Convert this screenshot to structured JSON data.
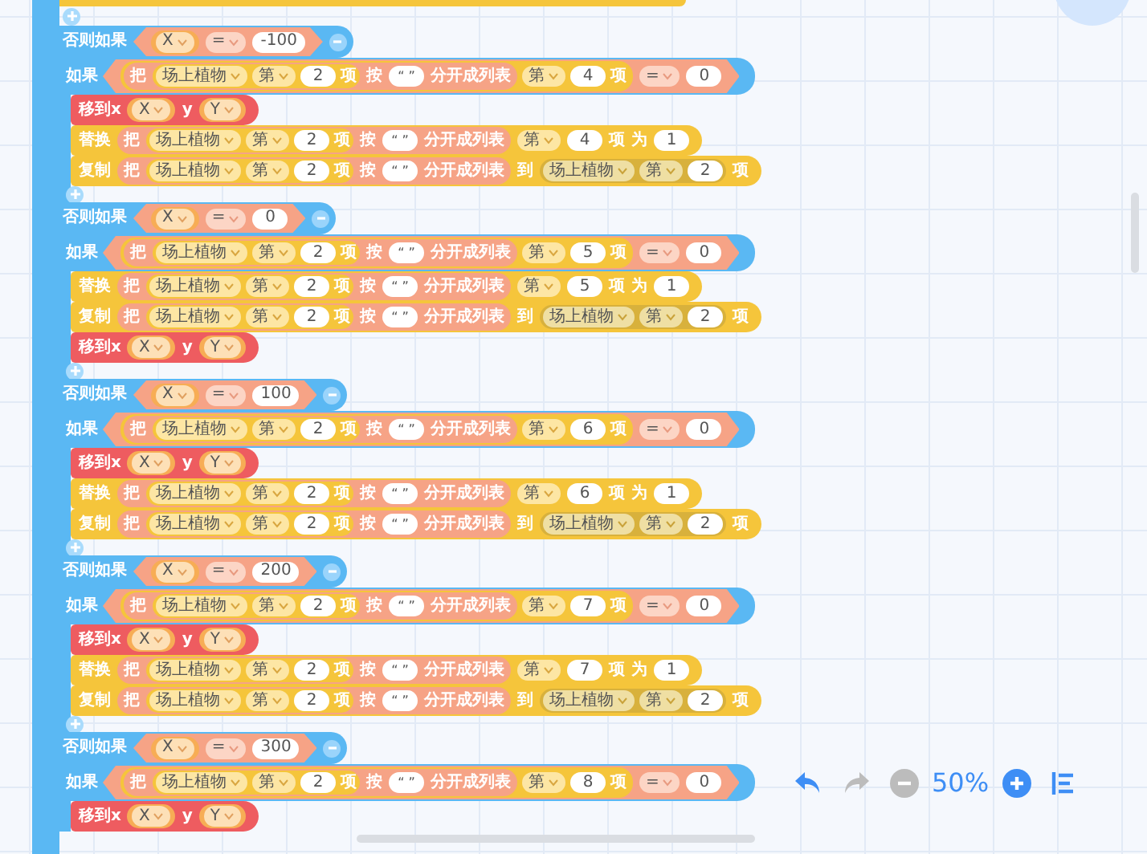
{
  "sections": [
    {
      "label": "否则如果",
      "var": "X",
      "op": "=",
      "value": "-100",
      "has_add_button": true,
      "if": {
        "label": "如果",
        "split": {
          "verb": "把",
          "list": "场上植物",
          "nth": "第",
          "index": "2",
          "item": "项",
          "by": "按",
          "sep": "“ ”",
          "action": "分开成列表"
        },
        "nth": "第",
        "index": "4",
        "item": "项",
        "op": "=",
        "value": "0"
      },
      "statements": [
        {
          "kind": "move",
          "label": "移到x",
          "x": "X",
          "y_label": "y",
          "y": "Y"
        },
        {
          "kind": "replace",
          "label": "替换",
          "split": {
            "verb": "把",
            "list": "场上植物",
            "nth": "第",
            "index": "2",
            "item": "项",
            "by": "按",
            "sep": "“ ”",
            "action": "分开成列表"
          },
          "nth": "第",
          "index": "4",
          "item": "项",
          "as": "为",
          "value": "1"
        },
        {
          "kind": "copy",
          "label": "复制",
          "split": {
            "verb": "把",
            "list": "场上植物",
            "nth": "第",
            "index": "2",
            "item": "项",
            "by": "按",
            "sep": "“ ”",
            "action": "分开成列表"
          },
          "to": "到",
          "list": "场上植物",
          "nth": "第",
          "index": "2",
          "item": "项"
        }
      ]
    },
    {
      "label": "否则如果",
      "var": "X",
      "op": "=",
      "value": "0",
      "has_add_button": true,
      "if": {
        "label": "如果",
        "split": {
          "verb": "把",
          "list": "场上植物",
          "nth": "第",
          "index": "2",
          "item": "项",
          "by": "按",
          "sep": "“ ”",
          "action": "分开成列表"
        },
        "nth": "第",
        "index": "5",
        "item": "项",
        "op": "=",
        "value": "0"
      },
      "statements": [
        {
          "kind": "replace",
          "label": "替换",
          "split": {
            "verb": "把",
            "list": "场上植物",
            "nth": "第",
            "index": "2",
            "item": "项",
            "by": "按",
            "sep": "“ ”",
            "action": "分开成列表"
          },
          "nth": "第",
          "index": "5",
          "item": "项",
          "as": "为",
          "value": "1"
        },
        {
          "kind": "copy",
          "label": "复制",
          "split": {
            "verb": "把",
            "list": "场上植物",
            "nth": "第",
            "index": "2",
            "item": "项",
            "by": "按",
            "sep": "“ ”",
            "action": "分开成列表"
          },
          "to": "到",
          "list": "场上植物",
          "nth": "第",
          "index": "2",
          "item": "项"
        },
        {
          "kind": "move",
          "label": "移到x",
          "x": "X",
          "y_label": "y",
          "y": "Y"
        }
      ]
    },
    {
      "label": "否则如果",
      "var": "X",
      "op": "=",
      "value": "100",
      "has_add_button": true,
      "if": {
        "label": "如果",
        "split": {
          "verb": "把",
          "list": "场上植物",
          "nth": "第",
          "index": "2",
          "item": "项",
          "by": "按",
          "sep": "“ ”",
          "action": "分开成列表"
        },
        "nth": "第",
        "index": "6",
        "item": "项",
        "op": "=",
        "value": "0"
      },
      "statements": [
        {
          "kind": "move",
          "label": "移到x",
          "x": "X",
          "y_label": "y",
          "y": "Y"
        },
        {
          "kind": "replace",
          "label": "替换",
          "split": {
            "verb": "把",
            "list": "场上植物",
            "nth": "第",
            "index": "2",
            "item": "项",
            "by": "按",
            "sep": "“ ”",
            "action": "分开成列表"
          },
          "nth": "第",
          "index": "6",
          "item": "项",
          "as": "为",
          "value": "1"
        },
        {
          "kind": "copy",
          "label": "复制",
          "split": {
            "verb": "把",
            "list": "场上植物",
            "nth": "第",
            "index": "2",
            "item": "项",
            "by": "按",
            "sep": "“ ”",
            "action": "分开成列表"
          },
          "to": "到",
          "list": "场上植物",
          "nth": "第",
          "index": "2",
          "item": "项"
        }
      ]
    },
    {
      "label": "否则如果",
      "var": "X",
      "op": "=",
      "value": "200",
      "has_add_button": true,
      "if": {
        "label": "如果",
        "split": {
          "verb": "把",
          "list": "场上植物",
          "nth": "第",
          "index": "2",
          "item": "项",
          "by": "按",
          "sep": "“ ”",
          "action": "分开成列表"
        },
        "nth": "第",
        "index": "7",
        "item": "项",
        "op": "=",
        "value": "0"
      },
      "statements": [
        {
          "kind": "move",
          "label": "移到x",
          "x": "X",
          "y_label": "y",
          "y": "Y"
        },
        {
          "kind": "replace",
          "label": "替换",
          "split": {
            "verb": "把",
            "list": "场上植物",
            "nth": "第",
            "index": "2",
            "item": "项",
            "by": "按",
            "sep": "“ ”",
            "action": "分开成列表"
          },
          "nth": "第",
          "index": "7",
          "item": "项",
          "as": "为",
          "value": "1"
        },
        {
          "kind": "copy",
          "label": "复制",
          "split": {
            "verb": "把",
            "list": "场上植物",
            "nth": "第",
            "index": "2",
            "item": "项",
            "by": "按",
            "sep": "“ ”",
            "action": "分开成列表"
          },
          "to": "到",
          "list": "场上植物",
          "nth": "第",
          "index": "2",
          "item": "项"
        }
      ]
    },
    {
      "label": "否则如果",
      "var": "X",
      "op": "=",
      "value": "300",
      "has_add_button": false,
      "if": {
        "label": "如果",
        "split": {
          "verb": "把",
          "list": "场上植物",
          "nth": "第",
          "index": "2",
          "item": "项",
          "by": "按",
          "sep": "“ ”",
          "action": "分开成列表"
        },
        "nth": "第",
        "index": "8",
        "item": "项",
        "op": "=",
        "value": "0"
      },
      "statements": [
        {
          "kind": "move",
          "label": "移到x",
          "x": "X",
          "y_label": "y",
          "y": "Y"
        }
      ]
    }
  ],
  "toolbar": {
    "undo": {
      "disabled": false
    },
    "redo": {
      "disabled": true
    },
    "zoom_out": {
      "disabled": true
    },
    "zoom": "50%",
    "zoom_in": {
      "disabled": false
    }
  }
}
